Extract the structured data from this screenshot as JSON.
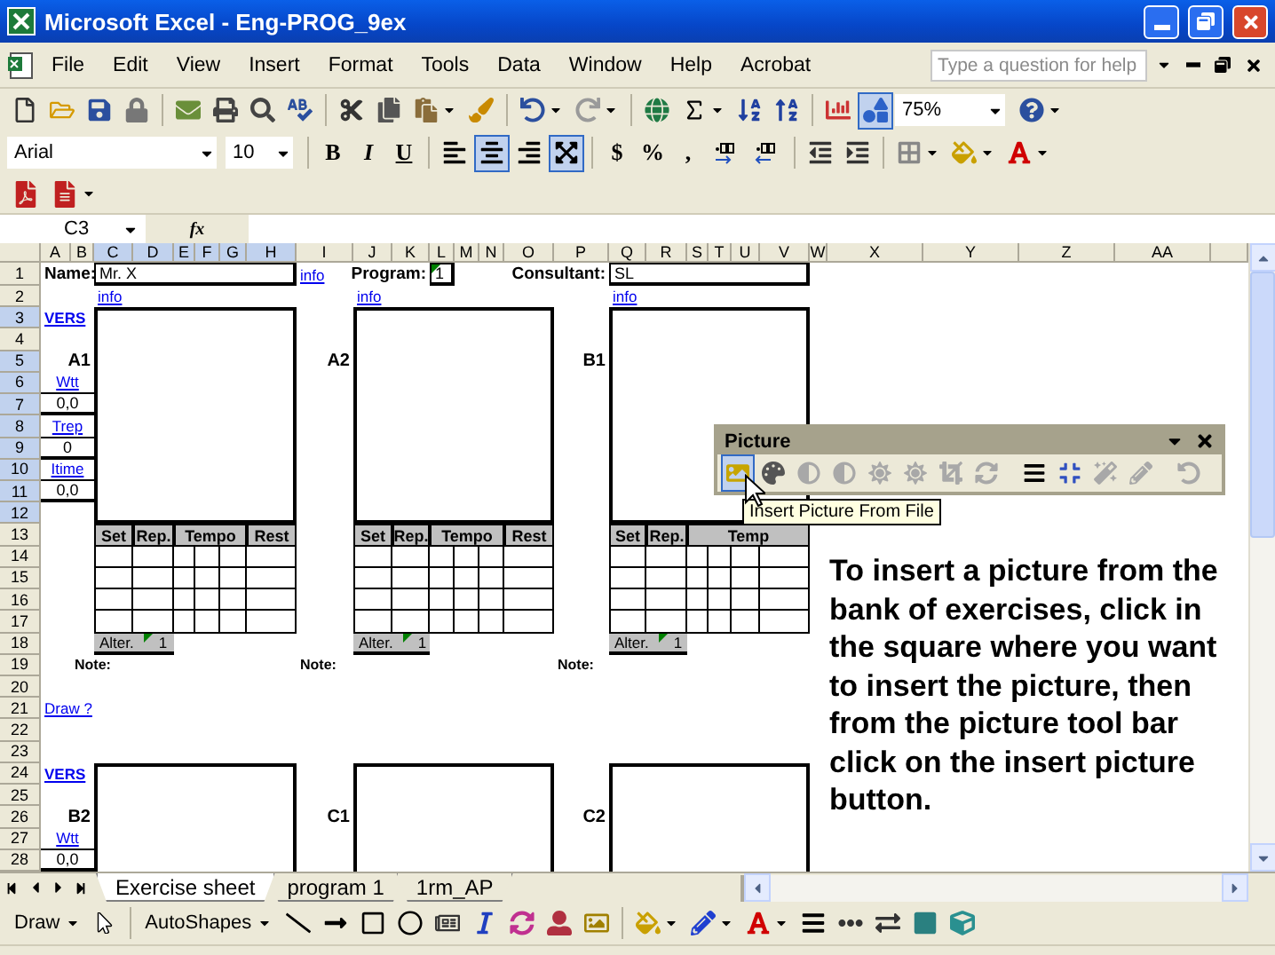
{
  "window": {
    "title": "Microsoft Excel - Eng-PROG_9ex"
  },
  "menu": {
    "items": [
      "File",
      "Edit",
      "View",
      "Insert",
      "Format",
      "Tools",
      "Data",
      "Window",
      "Help",
      "Acrobat"
    ],
    "help_placeholder": "Type a question for help"
  },
  "standard_toolbar": {
    "zoom": "75%",
    "buttons": [
      {
        "kind": "new",
        "selected": false
      },
      {
        "kind": "open",
        "selected": false
      },
      {
        "kind": "save",
        "selected": false
      },
      {
        "kind": "permission",
        "selected": false
      },
      {
        "kind": "email",
        "selected": false
      },
      {
        "kind": "print",
        "selected": false
      },
      {
        "kind": "preview",
        "selected": false
      },
      {
        "kind": "spelling",
        "selected": false
      },
      {
        "kind": "cut",
        "selected": false
      },
      {
        "kind": "copy",
        "selected": false
      },
      {
        "kind": "paste",
        "selected": false
      },
      {
        "kind": "format-painter",
        "selected": false
      },
      {
        "kind": "undo",
        "selected": false
      },
      {
        "kind": "redo",
        "selected": false
      },
      {
        "kind": "hyperlink",
        "selected": false
      },
      {
        "kind": "autosum",
        "selected": false
      },
      {
        "kind": "sort-asc",
        "selected": false
      },
      {
        "kind": "sort-desc",
        "selected": false
      },
      {
        "kind": "chart",
        "selected": false
      },
      {
        "kind": "drawing",
        "selected": true
      },
      {
        "kind": "help",
        "selected": false
      }
    ]
  },
  "formatting_toolbar": {
    "font": "Arial",
    "size": "10",
    "buttons": [
      {
        "kind": "bold",
        "label": "B",
        "selected": false
      },
      {
        "kind": "italic",
        "label": "I",
        "selected": false
      },
      {
        "kind": "underline",
        "label": "U",
        "selected": false
      },
      {
        "kind": "align-left",
        "selected": false
      },
      {
        "kind": "align-center",
        "selected": true
      },
      {
        "kind": "align-right",
        "selected": false
      },
      {
        "kind": "merge",
        "selected": true
      },
      {
        "kind": "currency",
        "label": "$",
        "selected": false
      },
      {
        "kind": "percent",
        "label": "%",
        "selected": false
      },
      {
        "kind": "comma",
        "label": ",",
        "selected": false
      },
      {
        "kind": "increase-decimal",
        "selected": false
      },
      {
        "kind": "decrease-decimal",
        "selected": false
      },
      {
        "kind": "outdent",
        "selected": false
      },
      {
        "kind": "indent",
        "selected": false
      },
      {
        "kind": "borders",
        "selected": false
      },
      {
        "kind": "fill-color",
        "selected": false
      },
      {
        "kind": "font-color",
        "selected": false
      }
    ]
  },
  "acrobat_toolbar": {
    "buttons": [
      {
        "kind": "pdf"
      },
      {
        "kind": "pdf-mail"
      }
    ]
  },
  "formula_bar": {
    "name_box": "C3",
    "fx": "fx"
  },
  "sheet": {
    "columns": [
      {
        "label": "A",
        "selected": false
      },
      {
        "label": "B",
        "selected": false
      },
      {
        "label": "C",
        "selected": true
      },
      {
        "label": "D",
        "selected": true
      },
      {
        "label": "E",
        "selected": true
      },
      {
        "label": "F",
        "selected": true
      },
      {
        "label": "G",
        "selected": true
      },
      {
        "label": "H",
        "selected": true
      },
      {
        "label": "I",
        "selected": false
      },
      {
        "label": "J",
        "selected": false
      },
      {
        "label": "K",
        "selected": false
      },
      {
        "label": "L",
        "selected": false
      },
      {
        "label": "M",
        "selected": false
      },
      {
        "label": "N",
        "selected": false
      },
      {
        "label": "O",
        "selected": false
      },
      {
        "label": "P",
        "selected": false
      },
      {
        "label": "Q",
        "selected": false
      },
      {
        "label": "R",
        "selected": false
      },
      {
        "label": "S",
        "selected": false
      },
      {
        "label": "T",
        "selected": false
      },
      {
        "label": "U",
        "selected": false
      },
      {
        "label": "V",
        "selected": false
      },
      {
        "label": "W",
        "selected": false
      },
      {
        "label": "X",
        "selected": false
      },
      {
        "label": "Y",
        "selected": false
      },
      {
        "label": "Z",
        "selected": false
      },
      {
        "label": "AA",
        "selected": false
      }
    ],
    "rows": [
      {
        "label": "1",
        "selected": false
      },
      {
        "label": "2",
        "selected": false
      },
      {
        "label": "3",
        "selected": true
      },
      {
        "label": "4",
        "selected": false
      },
      {
        "label": "5",
        "selected": true
      },
      {
        "label": "6",
        "selected": true
      },
      {
        "label": "7",
        "selected": true
      },
      {
        "label": "8",
        "selected": true
      },
      {
        "label": "9",
        "selected": true
      },
      {
        "label": "10",
        "selected": true
      },
      {
        "label": "11",
        "selected": true
      },
      {
        "label": "12",
        "selected": true
      },
      {
        "label": "13",
        "selected": false
      },
      {
        "label": "14",
        "selected": false
      },
      {
        "label": "15",
        "selected": false
      },
      {
        "label": "16",
        "selected": false
      },
      {
        "label": "17",
        "selected": false
      },
      {
        "label": "18",
        "selected": false
      },
      {
        "label": "19",
        "selected": false
      },
      {
        "label": "20",
        "selected": false
      },
      {
        "label": "21",
        "selected": false
      },
      {
        "label": "22",
        "selected": false
      },
      {
        "label": "23",
        "selected": false
      },
      {
        "label": "24",
        "selected": false
      },
      {
        "label": "25",
        "selected": false
      },
      {
        "label": "26",
        "selected": false
      },
      {
        "label": "27",
        "selected": false
      },
      {
        "label": "28",
        "selected": false
      }
    ],
    "header": {
      "name_label": "Name:",
      "name": "Mr. X",
      "info": "info",
      "program_label": "Program:",
      "program": "1",
      "consultant_label": "Consultant:",
      "consultant": "SL"
    },
    "side_top": [
      {
        "kind": "version",
        "text": "VERS"
      },
      {
        "kind": "link",
        "text": "Wtt"
      },
      {
        "kind": "value",
        "text": "0,0"
      },
      {
        "kind": "link",
        "text": "Trep"
      },
      {
        "kind": "value",
        "text": "0"
      },
      {
        "kind": "link",
        "text": "Itime"
      },
      {
        "kind": "value",
        "text": "0,0"
      }
    ],
    "draw_link": "Draw ?",
    "side_bottom": [
      {
        "kind": "version",
        "text": "VERS"
      },
      {
        "kind": "link",
        "text": "Wtt"
      },
      {
        "kind": "value",
        "text": "0,0"
      }
    ],
    "blocks": [
      {
        "label": "A1",
        "info": "info",
        "table_columns": [
          "Set",
          "Rep.",
          "Tempo",
          "Rest"
        ],
        "alter_label": "Alter.",
        "alter_value": "1",
        "note": "Note:"
      },
      {
        "label": "A2",
        "info": "info",
        "table_columns": [
          "Set",
          "Rep.",
          "Tempo",
          "Rest"
        ],
        "alter_label": "Alter.",
        "alter_value": "1",
        "note": "Note:"
      },
      {
        "label": "B1",
        "info": "info",
        "table_columns": [
          "Set",
          "Rep.",
          "Temp"
        ],
        "alter_label": "Alter.",
        "alter_value": "1",
        "note": "Note:"
      }
    ],
    "lower_blocks": [
      {
        "label": "B2"
      },
      {
        "label": "C1"
      },
      {
        "label": "C2"
      }
    ]
  },
  "picture_toolbar": {
    "title": "Picture",
    "tooltip": "Insert Picture From File",
    "buttons": [
      {
        "kind": "insert-picture",
        "selected": true,
        "disabled": false
      },
      {
        "kind": "color",
        "selected": false,
        "disabled": false
      },
      {
        "kind": "more-contrast",
        "selected": false,
        "disabled": true
      },
      {
        "kind": "less-contrast",
        "selected": false,
        "disabled": true
      },
      {
        "kind": "more-brightness",
        "selected": false,
        "disabled": true
      },
      {
        "kind": "less-brightness",
        "selected": false,
        "disabled": true
      },
      {
        "kind": "crop",
        "selected": false,
        "disabled": true
      },
      {
        "kind": "rotate",
        "selected": false,
        "disabled": true
      },
      {
        "kind": "line-style",
        "selected": false,
        "disabled": false
      },
      {
        "kind": "compress",
        "selected": false,
        "disabled": false
      },
      {
        "kind": "recolor",
        "selected": false,
        "disabled": true
      },
      {
        "kind": "format-picture",
        "selected": false,
        "disabled": true
      },
      {
        "kind": "reset-picture",
        "selected": false,
        "disabled": true
      }
    ]
  },
  "instruction": "To insert a picture from the bank of exercises, click in the square where you want to insert the picture, then from the picture tool bar click on the insert picture button.",
  "sheet_tabs": [
    {
      "label": "Exercise sheet",
      "selected": true
    },
    {
      "label": "program 1",
      "selected": false
    },
    {
      "label": "1rm_AP",
      "selected": false
    }
  ],
  "drawing_toolbar": {
    "draw": "Draw",
    "autoshapes": "AutoShapes",
    "buttons": [
      {
        "kind": "line"
      },
      {
        "kind": "arrow"
      },
      {
        "kind": "rectangle"
      },
      {
        "kind": "oval"
      },
      {
        "kind": "textbox"
      },
      {
        "kind": "wordart"
      },
      {
        "kind": "diagram"
      },
      {
        "kind": "clipart"
      },
      {
        "kind": "picture"
      },
      {
        "kind": "fill-color"
      },
      {
        "kind": "line-color"
      },
      {
        "kind": "font-color"
      },
      {
        "kind": "line-style"
      },
      {
        "kind": "dash-style"
      },
      {
        "kind": "arrow-style"
      },
      {
        "kind": "shadow"
      },
      {
        "kind": "extrude"
      }
    ]
  }
}
